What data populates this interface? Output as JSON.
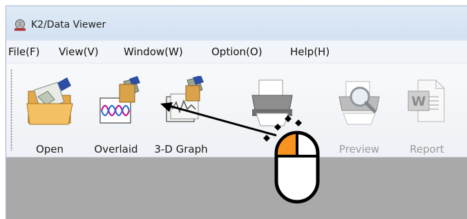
{
  "window": {
    "title": "K2/Data Viewer",
    "icon": "globe-seismograph-icon"
  },
  "menu": [
    {
      "label": "File(F)"
    },
    {
      "label": "View(V)"
    },
    {
      "label": "Window(W)"
    },
    {
      "label": "Option(O)"
    },
    {
      "label": "Help(H)"
    }
  ],
  "toolbar": {
    "buttons": [
      {
        "label": "Open",
        "icon": "open-folder-icon",
        "enabled": true
      },
      {
        "label": "Overlaid",
        "icon": "overlaid-waveform-icon",
        "enabled": true
      },
      {
        "label": "3-D Graph",
        "icon": "3d-graph-icon",
        "enabled": true
      },
      {
        "label": "",
        "icon": "printer-icon",
        "enabled": true
      },
      {
        "label": "Preview",
        "icon": "print-preview-icon",
        "enabled": false
      },
      {
        "label": "Report",
        "icon": "word-report-icon",
        "enabled": false
      }
    ]
  },
  "annotation": {
    "cursor_icon": "mouse-left-click-icon",
    "arrow_icon": "pointer-arrow-icon",
    "highlight_color": "#f7931e"
  }
}
